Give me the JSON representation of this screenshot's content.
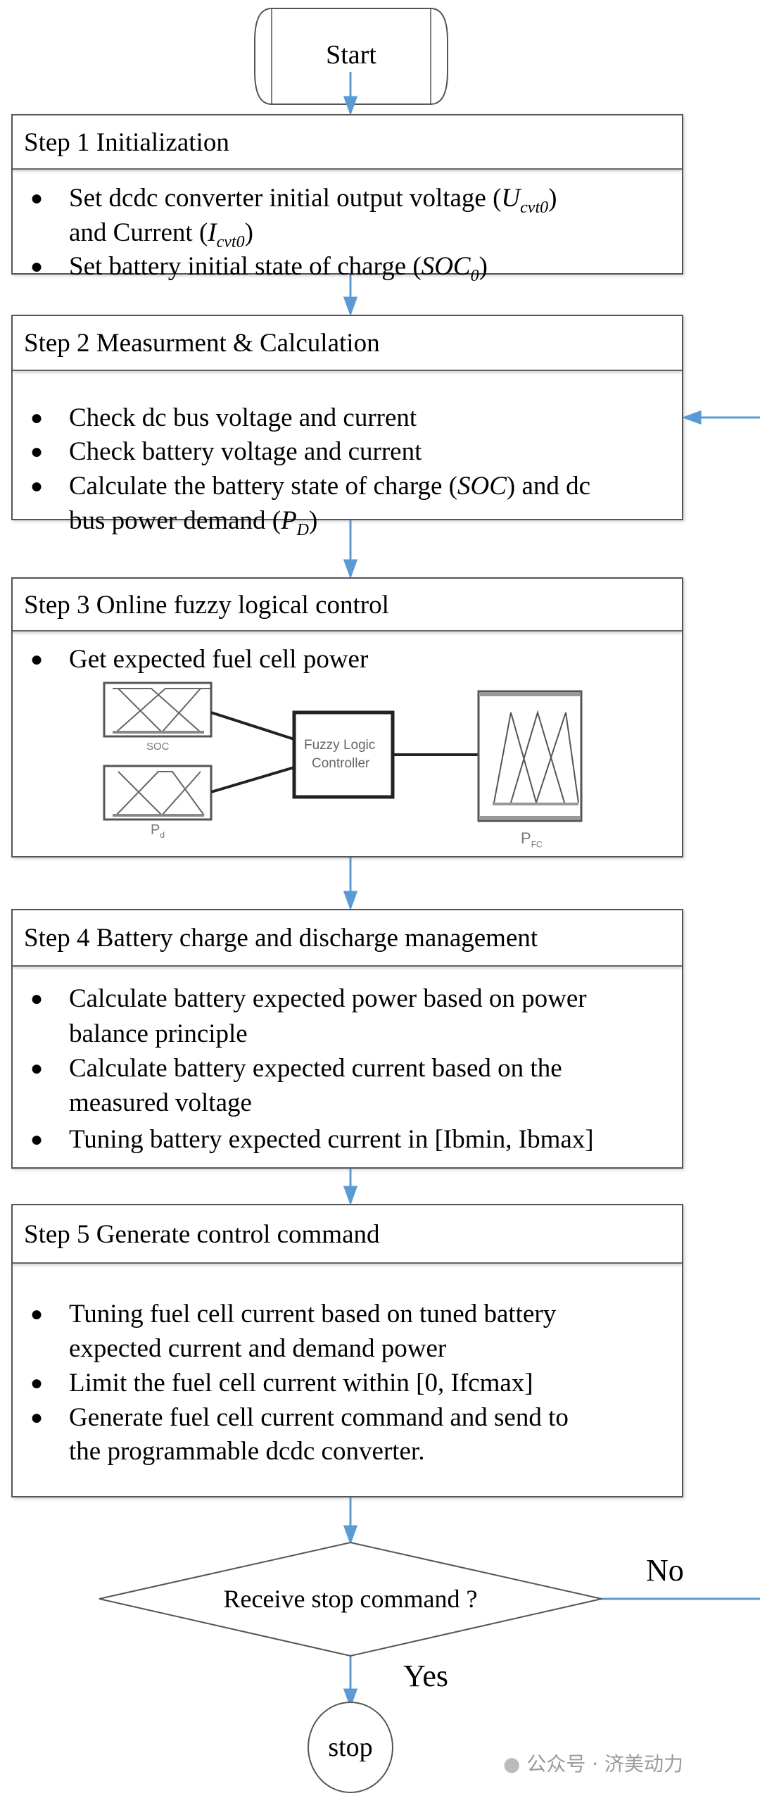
{
  "start_label": "Start",
  "stop_label": "stop",
  "decision": {
    "question": "Receive stop command ?",
    "no_label": "No",
    "yes_label": "Yes"
  },
  "steps": [
    {
      "header": "Step 1 Initialization",
      "lines": [
        {
          "bullet": true,
          "segs": [
            {
              "text": "Set dcdc converter initial output voltage (",
              "style": ""
            },
            {
              "text": "U",
              "style": "it"
            },
            {
              "text": "cvt0",
              "style": "sub"
            },
            {
              "text": ")",
              "style": ""
            }
          ]
        },
        {
          "bullet": false,
          "segs": [
            {
              "text": "and Current (",
              "style": ""
            },
            {
              "text": "I",
              "style": "it"
            },
            {
              "text": "cvt0",
              "style": "sub"
            },
            {
              "text": ")",
              "style": ""
            }
          ]
        },
        {
          "bullet": true,
          "segs": [
            {
              "text": "Set battery initial state of charge (",
              "style": ""
            },
            {
              "text": "SOC",
              "style": "it"
            },
            {
              "text": "0",
              "style": "sub"
            },
            {
              "text": ")",
              "style": ""
            }
          ]
        }
      ]
    },
    {
      "header": "Step 2 Measurment & Calculation",
      "lines": [
        {
          "bullet": true,
          "segs": [
            {
              "text": "Check dc bus voltage and current",
              "style": ""
            }
          ]
        },
        {
          "bullet": true,
          "segs": [
            {
              "text": "Check battery voltage and current",
              "style": ""
            }
          ]
        },
        {
          "bullet": true,
          "segs": [
            {
              "text": "Calculate the battery state of charge (",
              "style": ""
            },
            {
              "text": "SOC",
              "style": "it"
            },
            {
              "text": ") and dc",
              "style": ""
            }
          ]
        },
        {
          "bullet": false,
          "segs": [
            {
              "text": "bus power demand (",
              "style": ""
            },
            {
              "text": "P",
              "style": "it"
            },
            {
              "text": "D",
              "style": "sub"
            },
            {
              "text": ")",
              "style": ""
            }
          ]
        }
      ]
    },
    {
      "header": "Step 3 Online fuzzy logical control",
      "lines": [
        {
          "bullet": true,
          "segs": [
            {
              "text": "Get expected fuel cell power",
              "style": ""
            }
          ]
        }
      ]
    },
    {
      "header": "Step 4 Battery charge and discharge management",
      "lines": [
        {
          "bullet": true,
          "segs": [
            {
              "text": "Calculate battery expected power based on power",
              "style": ""
            }
          ]
        },
        {
          "bullet": false,
          "segs": [
            {
              "text": "balance principle",
              "style": ""
            }
          ]
        },
        {
          "bullet": true,
          "segs": [
            {
              "text": "Calculate battery expected current based on the",
              "style": ""
            }
          ]
        },
        {
          "bullet": false,
          "segs": [
            {
              "text": "measured voltage",
              "style": ""
            }
          ]
        },
        {
          "bullet": true,
          "segs": [
            {
              "text": "Tuning battery expected current in [Ibmin, Ibmax]",
              "style": ""
            }
          ]
        }
      ]
    },
    {
      "header": "Step 5 Generate control command",
      "lines": [
        {
          "bullet": true,
          "segs": [
            {
              "text": "Tuning fuel cell current based on tuned battery",
              "style": ""
            }
          ]
        },
        {
          "bullet": false,
          "segs": [
            {
              "text": "expected current and demand power",
              "style": ""
            }
          ]
        },
        {
          "bullet": true,
          "segs": [
            {
              "text": "Limit the fuel cell current within  [0, Ifcmax]",
              "style": ""
            }
          ]
        },
        {
          "bullet": true,
          "segs": [
            {
              "text": "Generate fuel cell current command and send to",
              "style": ""
            }
          ]
        },
        {
          "bullet": false,
          "segs": [
            {
              "text": "the programmable dcdc converter.",
              "style": ""
            }
          ]
        }
      ]
    }
  ],
  "fuzzy": {
    "controller_line1": "Fuzzy Logic",
    "controller_line2": "Controller",
    "input1": "SOC",
    "input2_main": "P",
    "input2_sub": "d",
    "output_main": "P",
    "output_sub": "FC"
  },
  "watermark": "公众号 · 济美动力",
  "colors": {
    "arrow": "#5b9bd5",
    "border": "#555555"
  }
}
